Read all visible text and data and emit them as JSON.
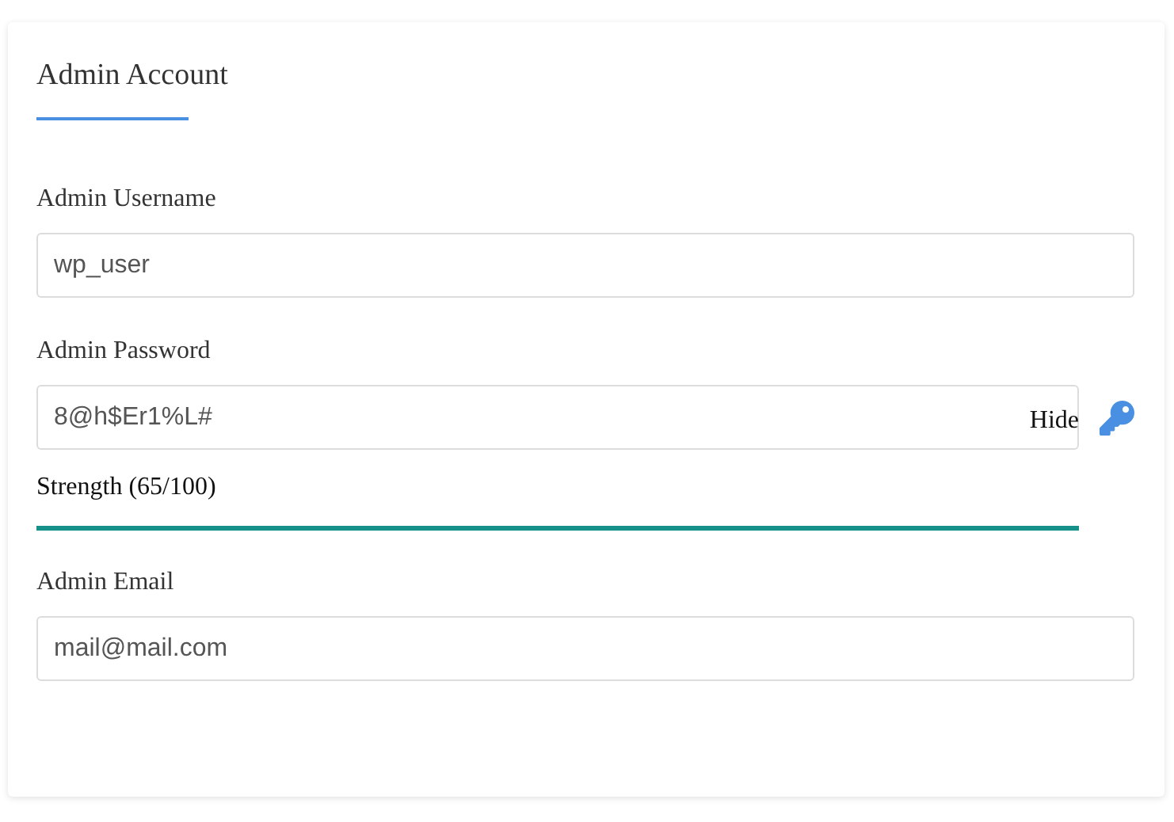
{
  "section": {
    "title": "Admin Account"
  },
  "fields": [
    {
      "kind": "text",
      "label": "Admin Username",
      "value": "wp_user"
    },
    {
      "kind": "password",
      "label": "Admin Password",
      "value": "8@h$Er1%L#",
      "toggle": "Hide",
      "strength": {
        "label": "Strength (65/100)"
      }
    },
    {
      "kind": "text",
      "label": "Admin Email",
      "value": "mail@mail.com"
    }
  ]
}
